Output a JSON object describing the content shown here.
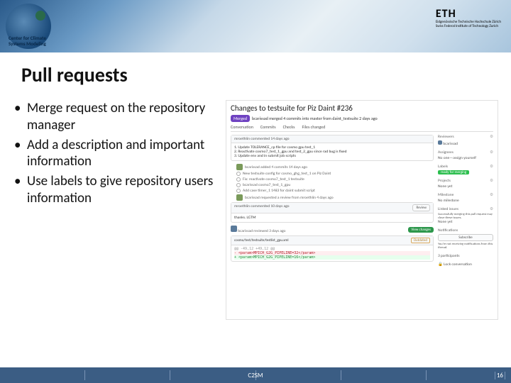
{
  "header": {
    "org_name_line1": "Center for Climate",
    "org_name_line2": "Systems Modeling",
    "org_abbrev": "C2SM",
    "eth_main": "ETH",
    "eth_sub1": "Eidgenössische Technische Hochschule Zürich",
    "eth_sub2": "Swiss Federal Institute of Technology Zurich"
  },
  "title": "Pull requests",
  "bullets": [
    "Merge request on the repository manager",
    "Add a description and important information",
    "Use labels to give repository users information"
  ],
  "github": {
    "pr_title": "Changes to testsuite for Piz Daint #236",
    "merged_label": "Merged",
    "byline": "bcarissad merged 4 commits into master from daint_testsuite 2 days ago",
    "tabs": {
      "conv": "Conversation",
      "commits": "Commits",
      "checks": "Checks",
      "files": "Files changed"
    },
    "first_comment_head": "mroethlin commented 14 days ago",
    "first_comment_items": [
      "1. Update TOLERANCE_cp file for cosmo gpu test_1",
      "2. Reactivate cosmo7_test_1_gpu and test_2_gpu since rad bug is fixed",
      "3. Update env and in submit job scripts"
    ],
    "added_commits_head": "bcarissad added 4 commits 14 days ago",
    "commits": [
      "New testsuite config for cosmo_ghg_test_1 on Piz Daint",
      "Fix: reactivate cosmo7_test_1 testsuite",
      "bcarissad cosmo7_test_1_gpu",
      "Add case timer_1 1483 for daint submit script"
    ],
    "review_request": "bcarissad requested a review from mroethlin 4 days ago",
    "comment2_head": "mroethlin commented 10 days ago",
    "comment2_body": "thanks. LGTM",
    "review_btn": "Review",
    "reviewed_line": "bcarissad reviewed 3 days ago",
    "view_changes": "View changes",
    "diff_file": "cosmo/test/testsuite/testlist_gpu.xml",
    "outdated": "Outdated",
    "diff_hunk": "@@ -49,12 +49,12 @@",
    "diff_del": "-        <param>MPICH_G2G_PIPELINE=32</param>",
    "diff_add": "+        <param>MPICH_G2G_PIPELINE=16</param>",
    "sidebar": {
      "reviewers": "Reviewers",
      "reviewer_name": "bcarissad",
      "assignees": "Assignees",
      "assignees_val": "No one—assign yourself",
      "labels": "Labels",
      "label_val": "ready for merging",
      "projects": "Projects",
      "projects_val": "None yet",
      "milestone": "Milestone",
      "milestone_val": "No milestone",
      "linked": "Linked issues",
      "linked_val": "Successfully merging this pull request may close these issues.",
      "linked_none": "None yet",
      "notifications": "Notifications",
      "subscribe": "Subscribe",
      "subscribe_note": "You're not receiving notifications from this thread.",
      "participants": "3 participants",
      "lock": "Lock conversation"
    }
  },
  "footer": {
    "center": "C2SM",
    "page": "16"
  }
}
